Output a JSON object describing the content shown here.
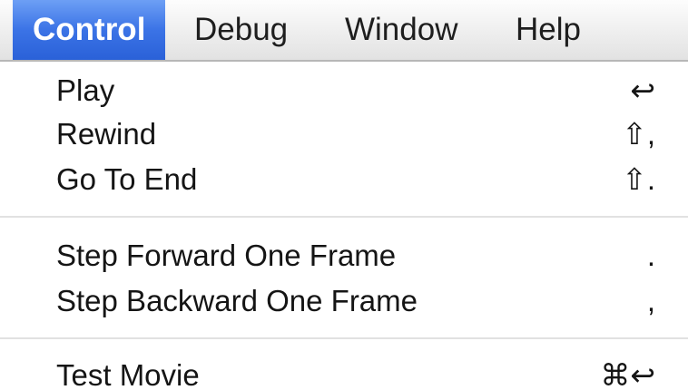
{
  "menubar": {
    "items": [
      {
        "label": "Control",
        "active": true
      },
      {
        "label": "Debug",
        "active": false
      },
      {
        "label": "Window",
        "active": false
      },
      {
        "label": "Help",
        "active": false
      }
    ]
  },
  "control_menu": {
    "groups": [
      {
        "items": [
          {
            "label": "Play",
            "shortcut": "↩"
          },
          {
            "label": "Rewind",
            "shortcut": "⇧,"
          },
          {
            "label": "Go To End",
            "shortcut": "⇧."
          }
        ]
      },
      {
        "items": [
          {
            "label": "Step Forward One Frame",
            "shortcut": "."
          },
          {
            "label": "Step Backward One Frame",
            "shortcut": ","
          }
        ]
      },
      {
        "items": [
          {
            "label": "Test Movie",
            "shortcut": "⌘↩"
          }
        ]
      }
    ]
  },
  "colors": {
    "highlight": "#3b73e6",
    "menubar_background": "#eeeeee",
    "menu_background": "#ffffff",
    "text": "#151515"
  }
}
